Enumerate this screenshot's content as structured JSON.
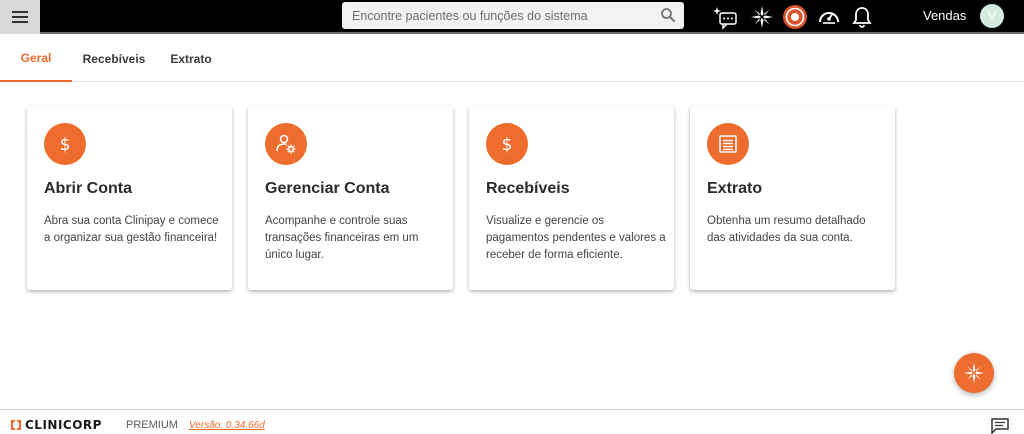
{
  "header": {
    "search_placeholder": "Encontre pacientes ou funções do sistema",
    "user_name": "Vendas",
    "avatar_initial": "V",
    "icons": [
      "menu-icon",
      "search-icon",
      "ai-chat-icon",
      "sparkle-icon",
      "record-icon",
      "speedometer-icon",
      "bell-icon"
    ]
  },
  "tabs": [
    {
      "label": "Geral",
      "active": true
    },
    {
      "label": "Recebíveis",
      "active": false
    },
    {
      "label": "Extrato",
      "active": false
    }
  ],
  "cards": [
    {
      "icon": "dollar-icon",
      "title": "Abrir Conta",
      "description": "Abra sua conta Clinipay e comece a organizar sua gestão financeira!"
    },
    {
      "icon": "user-settings-icon",
      "title": "Gerenciar Conta",
      "description": "Acompanhe e controle suas transações financeiras em um único lugar."
    },
    {
      "icon": "dollar-icon",
      "title": "Recebíveis",
      "description": "Visualize e gerencie os pagamentos pendentes e valores a receber de forma eficiente."
    },
    {
      "icon": "document-list-icon",
      "title": "Extrato",
      "description": "Obtenha um resumo detalhado das atividades da sua conta."
    }
  ],
  "footer": {
    "logo_text": "CLINICORP",
    "plan": "PREMIUM",
    "version": "Versão: 0.34.66d"
  },
  "colors": {
    "accent": "#ee6c2d",
    "topbar": "#000000"
  }
}
